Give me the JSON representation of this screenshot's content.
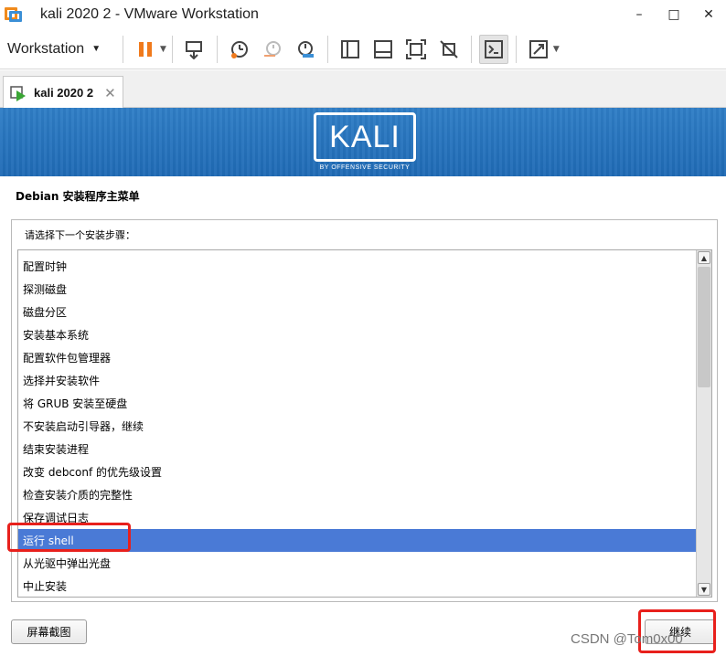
{
  "window": {
    "title": "kali 2020 2 - VMware Workstation",
    "controls": [
      "–",
      "□",
      "✕"
    ]
  },
  "toolbar": {
    "workstation_menu": "Workstation",
    "icons": [
      "pause-icon",
      "send-keys-icon",
      "snapshot-icon",
      "revert-snapshot-icon",
      "snapshot-manager-icon",
      "sidebar-icon",
      "thumbnail-bar-icon",
      "fullscreen-icon",
      "unity-icon",
      "console-icon",
      "stretch-icon"
    ]
  },
  "tab": {
    "label": "kali 2020 2",
    "close": "✕"
  },
  "banner": {
    "logo_text": "KALI",
    "logo_sub": "BY OFFENSIVE SECURITY"
  },
  "installer": {
    "title": "Debian 安装程序主菜单",
    "prompt": "请选择下一个安装步骤：",
    "items": [
      "配置时钟",
      "探测磁盘",
      "磁盘分区",
      "安装基本系统",
      "配置软件包管理器",
      "选择并安装软件",
      "将 GRUB 安装至硬盘",
      "不安装启动引导器，继续",
      "结束安装进程",
      "改变 debconf 的优先级设置",
      "检查安装介质的完整性",
      "保存调试日志",
      "运行 shell",
      "从光驱中弹出光盘",
      "中止安装"
    ],
    "selected_index": 12,
    "screenshot_button": "屏幕截图",
    "continue_button": "继续"
  },
  "watermark": "CSDN @Tom0x00",
  "colors": {
    "selection": "#4a7ad6",
    "banner": "#2a78c2",
    "highlight_box": "#e8201c",
    "pause": "#f07a1c"
  }
}
